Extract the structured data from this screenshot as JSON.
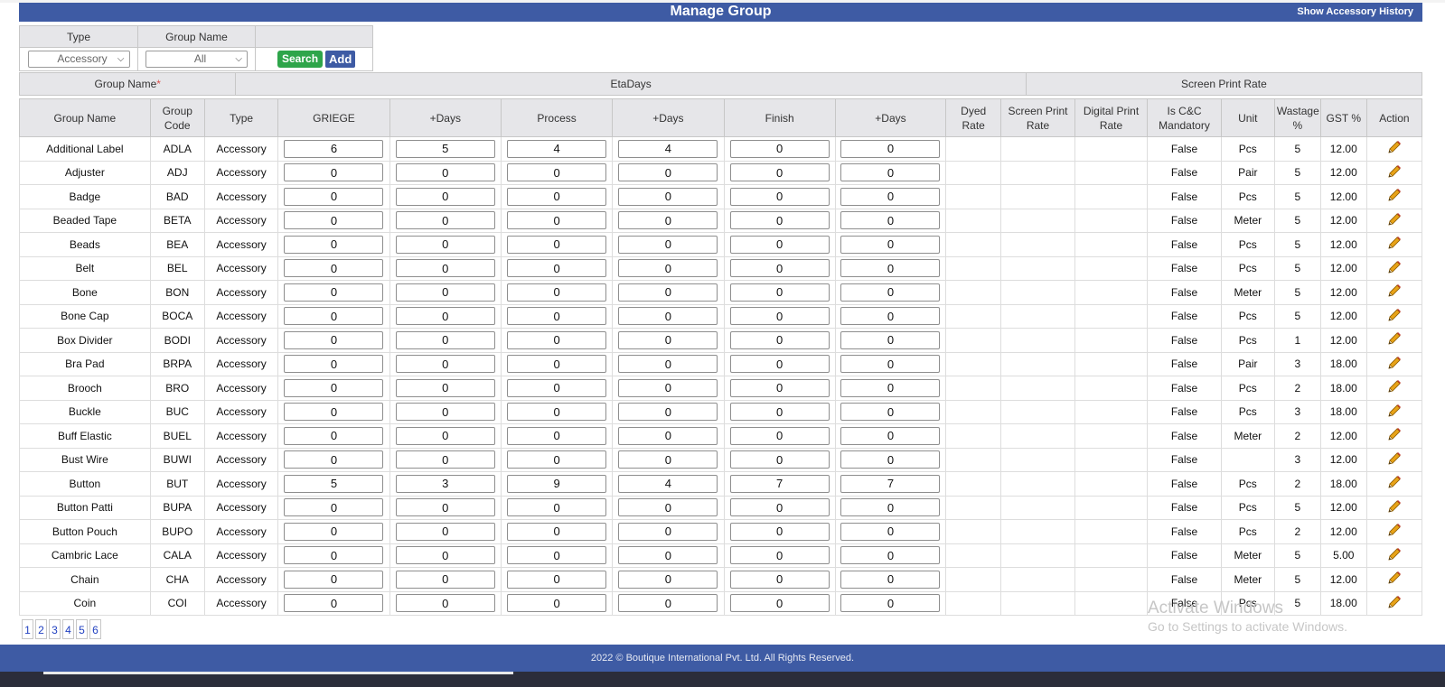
{
  "header": {
    "title": "Manage Group",
    "history_link": "Show Accessory History"
  },
  "filter": {
    "type_label": "Type",
    "group_name_label": "Group Name",
    "type_value": "Accessory",
    "group_name_value": "All",
    "search_label": "Search",
    "add_label": "Add"
  },
  "section_headers": {
    "group_name": "Group Name",
    "required_mark": "*",
    "eta_days": "EtaDays",
    "screen_print_rate": "Screen Print Rate"
  },
  "columns": [
    "Group Name",
    "Group Code",
    "Type",
    "GRIEGE",
    "+Days",
    "Process",
    "+Days",
    "Finish",
    "+Days",
    "Dyed Rate",
    "Screen Print Rate",
    "Digital Print Rate",
    "Is C&C Mandatory",
    "Unit",
    "Wastage %",
    "GST %",
    "Action"
  ],
  "rows": [
    {
      "name": "Additional Label",
      "code": "ADLA",
      "type": "Accessory",
      "griege": "6",
      "griege_days": "5",
      "process": "4",
      "process_days": "4",
      "finish": "0",
      "finish_days": "0",
      "mandatory": "False",
      "unit": "Pcs",
      "wastage": "5",
      "gst": "12.00"
    },
    {
      "name": "Adjuster",
      "code": "ADJ",
      "type": "Accessory",
      "griege": "0",
      "griege_days": "0",
      "process": "0",
      "process_days": "0",
      "finish": "0",
      "finish_days": "0",
      "mandatory": "False",
      "unit": "Pair",
      "wastage": "5",
      "gst": "12.00"
    },
    {
      "name": "Badge",
      "code": "BAD",
      "type": "Accessory",
      "griege": "0",
      "griege_days": "0",
      "process": "0",
      "process_days": "0",
      "finish": "0",
      "finish_days": "0",
      "mandatory": "False",
      "unit": "Pcs",
      "wastage": "5",
      "gst": "12.00"
    },
    {
      "name": "Beaded Tape",
      "code": "BETA",
      "type": "Accessory",
      "griege": "0",
      "griege_days": "0",
      "process": "0",
      "process_days": "0",
      "finish": "0",
      "finish_days": "0",
      "mandatory": "False",
      "unit": "Meter",
      "wastage": "5",
      "gst": "12.00"
    },
    {
      "name": "Beads",
      "code": "BEA",
      "type": "Accessory",
      "griege": "0",
      "griege_days": "0",
      "process": "0",
      "process_days": "0",
      "finish": "0",
      "finish_days": "0",
      "mandatory": "False",
      "unit": "Pcs",
      "wastage": "5",
      "gst": "12.00"
    },
    {
      "name": "Belt",
      "code": "BEL",
      "type": "Accessory",
      "griege": "0",
      "griege_days": "0",
      "process": "0",
      "process_days": "0",
      "finish": "0",
      "finish_days": "0",
      "mandatory": "False",
      "unit": "Pcs",
      "wastage": "5",
      "gst": "12.00"
    },
    {
      "name": "Bone",
      "code": "BON",
      "type": "Accessory",
      "griege": "0",
      "griege_days": "0",
      "process": "0",
      "process_days": "0",
      "finish": "0",
      "finish_days": "0",
      "mandatory": "False",
      "unit": "Meter",
      "wastage": "5",
      "gst": "12.00"
    },
    {
      "name": "Bone Cap",
      "code": "BOCA",
      "type": "Accessory",
      "griege": "0",
      "griege_days": "0",
      "process": "0",
      "process_days": "0",
      "finish": "0",
      "finish_days": "0",
      "mandatory": "False",
      "unit": "Pcs",
      "wastage": "5",
      "gst": "12.00"
    },
    {
      "name": "Box Divider",
      "code": "BODI",
      "type": "Accessory",
      "griege": "0",
      "griege_days": "0",
      "process": "0",
      "process_days": "0",
      "finish": "0",
      "finish_days": "0",
      "mandatory": "False",
      "unit": "Pcs",
      "wastage": "1",
      "gst": "12.00"
    },
    {
      "name": "Bra Pad",
      "code": "BRPA",
      "type": "Accessory",
      "griege": "0",
      "griege_days": "0",
      "process": "0",
      "process_days": "0",
      "finish": "0",
      "finish_days": "0",
      "mandatory": "False",
      "unit": "Pair",
      "wastage": "3",
      "gst": "18.00"
    },
    {
      "name": "Brooch",
      "code": "BRO",
      "type": "Accessory",
      "griege": "0",
      "griege_days": "0",
      "process": "0",
      "process_days": "0",
      "finish": "0",
      "finish_days": "0",
      "mandatory": "False",
      "unit": "Pcs",
      "wastage": "2",
      "gst": "18.00"
    },
    {
      "name": "Buckle",
      "code": "BUC",
      "type": "Accessory",
      "griege": "0",
      "griege_days": "0",
      "process": "0",
      "process_days": "0",
      "finish": "0",
      "finish_days": "0",
      "mandatory": "False",
      "unit": "Pcs",
      "wastage": "3",
      "gst": "18.00"
    },
    {
      "name": "Buff Elastic",
      "code": "BUEL",
      "type": "Accessory",
      "griege": "0",
      "griege_days": "0",
      "process": "0",
      "process_days": "0",
      "finish": "0",
      "finish_days": "0",
      "mandatory": "False",
      "unit": "Meter",
      "wastage": "2",
      "gst": "12.00"
    },
    {
      "name": "Bust Wire",
      "code": "BUWI",
      "type": "Accessory",
      "griege": "0",
      "griege_days": "0",
      "process": "0",
      "process_days": "0",
      "finish": "0",
      "finish_days": "0",
      "mandatory": "False",
      "unit": "",
      "wastage": "3",
      "gst": "12.00"
    },
    {
      "name": "Button",
      "code": "BUT",
      "type": "Accessory",
      "griege": "5",
      "griege_days": "3",
      "process": "9",
      "process_days": "4",
      "finish": "7",
      "finish_days": "7",
      "mandatory": "False",
      "unit": "Pcs",
      "wastage": "2",
      "gst": "18.00"
    },
    {
      "name": "Button Patti",
      "code": "BUPA",
      "type": "Accessory",
      "griege": "0",
      "griege_days": "0",
      "process": "0",
      "process_days": "0",
      "finish": "0",
      "finish_days": "0",
      "mandatory": "False",
      "unit": "Pcs",
      "wastage": "5",
      "gst": "12.00"
    },
    {
      "name": "Button Pouch",
      "code": "BUPO",
      "type": "Accessory",
      "griege": "0",
      "griege_days": "0",
      "process": "0",
      "process_days": "0",
      "finish": "0",
      "finish_days": "0",
      "mandatory": "False",
      "unit": "Pcs",
      "wastage": "2",
      "gst": "12.00"
    },
    {
      "name": "Cambric Lace",
      "code": "CALA",
      "type": "Accessory",
      "griege": "0",
      "griege_days": "0",
      "process": "0",
      "process_days": "0",
      "finish": "0",
      "finish_days": "0",
      "mandatory": "False",
      "unit": "Meter",
      "wastage": "5",
      "gst": "5.00"
    },
    {
      "name": "Chain",
      "code": "CHA",
      "type": "Accessory",
      "griege": "0",
      "griege_days": "0",
      "process": "0",
      "process_days": "0",
      "finish": "0",
      "finish_days": "0",
      "mandatory": "False",
      "unit": "Meter",
      "wastage": "5",
      "gst": "12.00"
    },
    {
      "name": "Coin",
      "code": "COI",
      "type": "Accessory",
      "griege": "0",
      "griege_days": "0",
      "process": "0",
      "process_days": "0",
      "finish": "0",
      "finish_days": "0",
      "mandatory": "False",
      "unit": "Pcs",
      "wastage": "5",
      "gst": "18.00"
    }
  ],
  "pagination": [
    "1",
    "2",
    "3",
    "4",
    "5",
    "6"
  ],
  "watermark": {
    "line1": "Activate Windows",
    "line2": "Go to Settings to activate Windows."
  },
  "footer": "2022 © Boutique International Pvt. Ltd. All Rights Reserved.",
  "icons": {
    "edit": "pencil-icon",
    "dropdown": "chevron-down-icon"
  },
  "colors": {
    "brand": "#3e5ba4",
    "search": "#2ea54a",
    "header_bg": "#e6e6e9",
    "required": "#d9534f"
  }
}
